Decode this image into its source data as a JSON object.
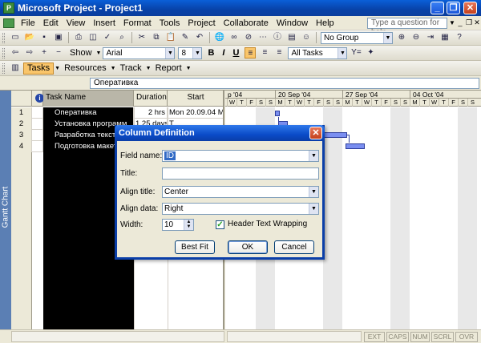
{
  "window": {
    "title": "Microsoft Project - Project1",
    "minimize": "_",
    "restore": "❐",
    "close": "✕",
    "app_icon": "project-app-icon"
  },
  "menu": {
    "items": [
      "File",
      "Edit",
      "View",
      "Insert",
      "Format",
      "Tools",
      "Project",
      "Collaborate",
      "Window",
      "Help"
    ],
    "help_placeholder": "Type a question for help",
    "doc_minimize": "_",
    "doc_restore": "❐",
    "doc_close": "✕"
  },
  "toolbar1": {
    "group_select": "No Group"
  },
  "toolbar2": {
    "show_label": "Show",
    "font": "Arial",
    "size": "8",
    "bold": "B",
    "italic": "I",
    "underline": "U",
    "filter": "All Tasks"
  },
  "toolbar3": {
    "tasks": "Tasks",
    "resources": "Resources",
    "track": "Track",
    "report": "Report"
  },
  "entry_bar": {
    "value": "Оперативка"
  },
  "view_bar": {
    "label": "Gantt Chart"
  },
  "table": {
    "headers": {
      "name": "Task Name",
      "duration": "Duration",
      "start": "Start"
    },
    "rows": [
      {
        "id": "1",
        "name": "Оперативка",
        "duration": "2 hrs",
        "start": "Mon 20.09.04",
        "extra": "M"
      },
      {
        "id": "2",
        "name": "Установка программ",
        "duration": "1.25 days",
        "start": "",
        "extra": "T"
      },
      {
        "id": "3",
        "name": "Разработка тексто",
        "duration": "",
        "start": "",
        "extra": ""
      },
      {
        "id": "4",
        "name": "Подготовка макете",
        "duration": "",
        "start": "",
        "extra": ""
      }
    ]
  },
  "gantt": {
    "weeks": [
      "р '04",
      "20 Sep '04",
      "27 Sep '04",
      "04 Oct '04"
    ],
    "days": [
      "W",
      "T",
      "F",
      "S",
      "S",
      "M",
      "T",
      "W",
      "T",
      "F",
      "S",
      "S",
      "M",
      "T",
      "W",
      "T",
      "F",
      "S",
      "S",
      "M",
      "T",
      "W",
      "T",
      "F",
      "S",
      "S"
    ]
  },
  "dialog": {
    "title": "Column Definition",
    "field_name_label": "Field name:",
    "field_name_value": "ID",
    "title_label": "Title:",
    "title_value": "",
    "align_title_label": "Align title:",
    "align_title_value": "Center",
    "align_data_label": "Align data:",
    "align_data_value": "Right",
    "width_label": "Width:",
    "width_value": "10",
    "wrap_label": "Header Text Wrapping",
    "wrap_checked": true,
    "best_fit": "Best Fit",
    "ok": "OK",
    "cancel": "Cancel"
  },
  "status": {
    "indicators": [
      "EXT",
      "CAPS",
      "NUM",
      "SCRL",
      "OVR"
    ]
  },
  "colors": {
    "title_blue": "#0a4bc8",
    "selection": "#316ac5",
    "task_bar": "#7a8ef0"
  }
}
